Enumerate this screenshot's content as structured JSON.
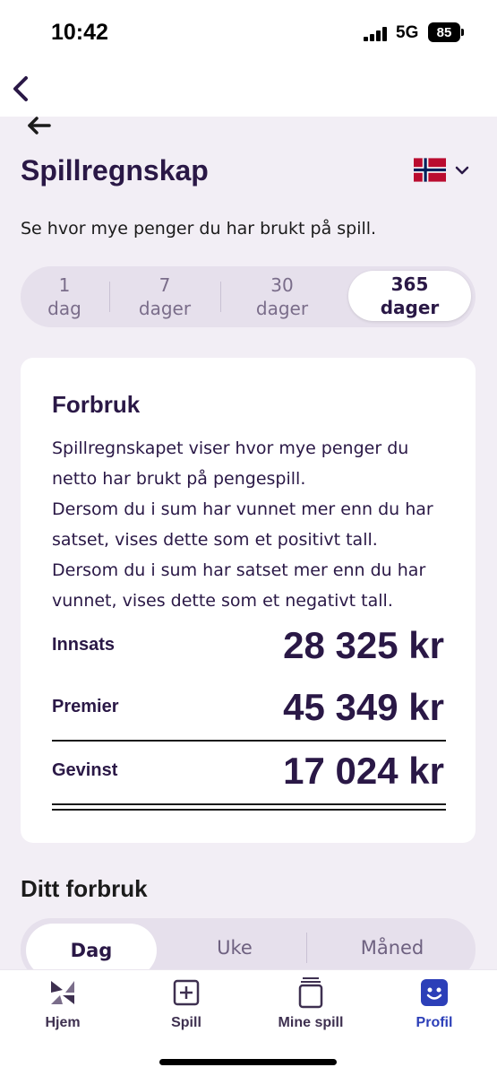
{
  "status_bar": {
    "time": "10:42",
    "network": "5G",
    "battery": "85"
  },
  "header": {
    "title": "Spillregnskap",
    "subtitle": "Se hvor mye penger du har brukt på spill."
  },
  "period_tabs": [
    {
      "number": "1",
      "unit": "dag",
      "selected": false
    },
    {
      "number": "7",
      "unit": "dager",
      "selected": false
    },
    {
      "number": "30",
      "unit": "dager",
      "selected": false
    },
    {
      "number": "365",
      "unit": "dager",
      "selected": true
    }
  ],
  "card": {
    "title": "Forbruk",
    "paragraphs": [
      "Spillregnskapet viser hvor mye penger du netto har brukt på pengespill.",
      "Dersom du i sum har vunnet mer enn du har satset, vises dette som et positivt tall.",
      "Dersom du i sum har satset mer enn du har vunnet, vises dette som et negativt tall."
    ],
    "rows": [
      {
        "label": "Innsats",
        "value": "28 325 kr"
      },
      {
        "label": "Premier",
        "value": "45 349 kr"
      },
      {
        "label": "Gevinst",
        "value": "17 024 kr"
      }
    ]
  },
  "consumption": {
    "title": "Ditt forbruk",
    "tabs": [
      {
        "label": "Dag",
        "selected": true
      },
      {
        "label": "Uke",
        "selected": false
      },
      {
        "label": "Måned",
        "selected": false
      }
    ]
  },
  "bottom_nav": [
    {
      "label": "Hjem",
      "icon": "home-logo-icon",
      "active": false
    },
    {
      "label": "Spill",
      "icon": "plus-square-icon",
      "active": false
    },
    {
      "label": "Mine spill",
      "icon": "stacked-tickets-icon",
      "active": false
    },
    {
      "label": "Profil",
      "icon": "smiley-face-icon",
      "active": true
    }
  ],
  "colors": {
    "text": "#2a1846",
    "background": "#f2eef5",
    "active_nav": "#2c3fb8"
  },
  "icons": {
    "back": "chevron-left-icon",
    "back_arrow": "arrow-left-icon",
    "language": "norway-flag-icon",
    "language_dropdown": "chevron-down-icon"
  }
}
